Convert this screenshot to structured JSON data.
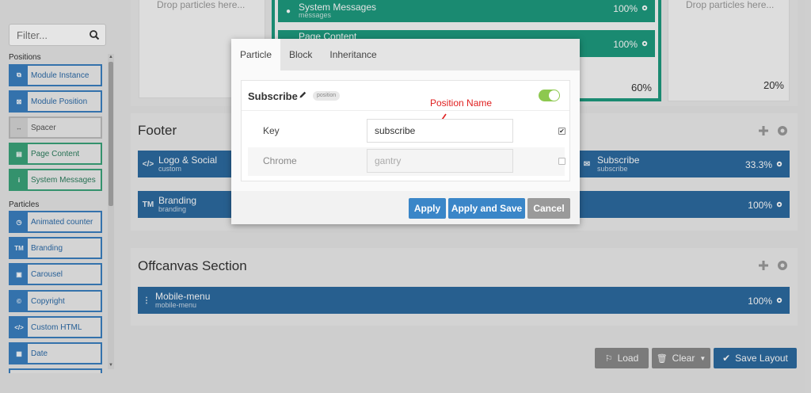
{
  "sidebar": {
    "filter_placeholder": "Filter...",
    "positions_heading": "Positions",
    "positions": [
      {
        "label": "Module Instance",
        "icon": "module-instance-icon",
        "glyph": "⧉"
      },
      {
        "label": "Module Position",
        "icon": "module-position-icon",
        "glyph": "⊠"
      },
      {
        "label": "Spacer",
        "icon": "spacer-icon",
        "glyph": "↔"
      },
      {
        "label": "Page Content",
        "icon": "page-content-icon",
        "glyph": "▤"
      },
      {
        "label": "System Messages",
        "icon": "info-icon",
        "glyph": "i"
      }
    ],
    "particles_heading": "Particles",
    "particles": [
      {
        "label": "Animated counter",
        "icon": "clock-icon",
        "glyph": "◷"
      },
      {
        "label": "Branding",
        "icon": "trademark-icon",
        "glyph": "TM"
      },
      {
        "label": "Carousel",
        "icon": "image-icon",
        "glyph": "▣"
      },
      {
        "label": "Copyright",
        "icon": "copyright-icon",
        "glyph": "©"
      },
      {
        "label": "Custom HTML",
        "icon": "code-icon",
        "glyph": "</>"
      },
      {
        "label": "Date",
        "icon": "calendar-icon",
        "glyph": "▦"
      }
    ]
  },
  "top": {
    "drop_left": "Drop particles here...",
    "drop_right": "Drop particles here...",
    "system_messages": {
      "title": "System Messages",
      "sub": "messages",
      "pct": "100%"
    },
    "page_content": {
      "title": "Page Content",
      "pct": "100%"
    },
    "pct_60": "60%",
    "pct_20": "20%"
  },
  "footer": {
    "title": "Footer",
    "logo": {
      "title": "Logo & Social",
      "sub": "custom"
    },
    "subscribe": {
      "title": "Subscribe",
      "sub": "subscribe",
      "pct": "33.3%"
    },
    "branding": {
      "title": "Branding",
      "sub": "branding",
      "pct": "100%"
    }
  },
  "offcanvas": {
    "title": "Offcanvas Section",
    "mobile": {
      "title": "Mobile-menu",
      "sub": "mobile-menu",
      "pct": "100%"
    }
  },
  "bottom_buttons": {
    "load": "Load",
    "clear": "Clear",
    "save": "Save Layout"
  },
  "modal": {
    "tabs": [
      "Particle",
      "Block",
      "Inheritance"
    ],
    "card_title": "Subscribe",
    "badge": "position",
    "toggle_on": true,
    "key_label": "Key",
    "key_value": "subscribe",
    "key_checked": true,
    "chrome_label": "Chrome",
    "chrome_placeholder": "gantry",
    "chrome_checked": false,
    "annotation": "Position Name",
    "apply": "Apply",
    "apply_save": "Apply and Save",
    "cancel": "Cancel"
  },
  "colors": {
    "blue": "#2c6aa0",
    "teal": "#1e9a7e",
    "apply_blue": "#3a86c8",
    "gray_btn": "#9a9a9a",
    "toggle_green": "#8dc84f",
    "annotation_red": "#e02020"
  }
}
